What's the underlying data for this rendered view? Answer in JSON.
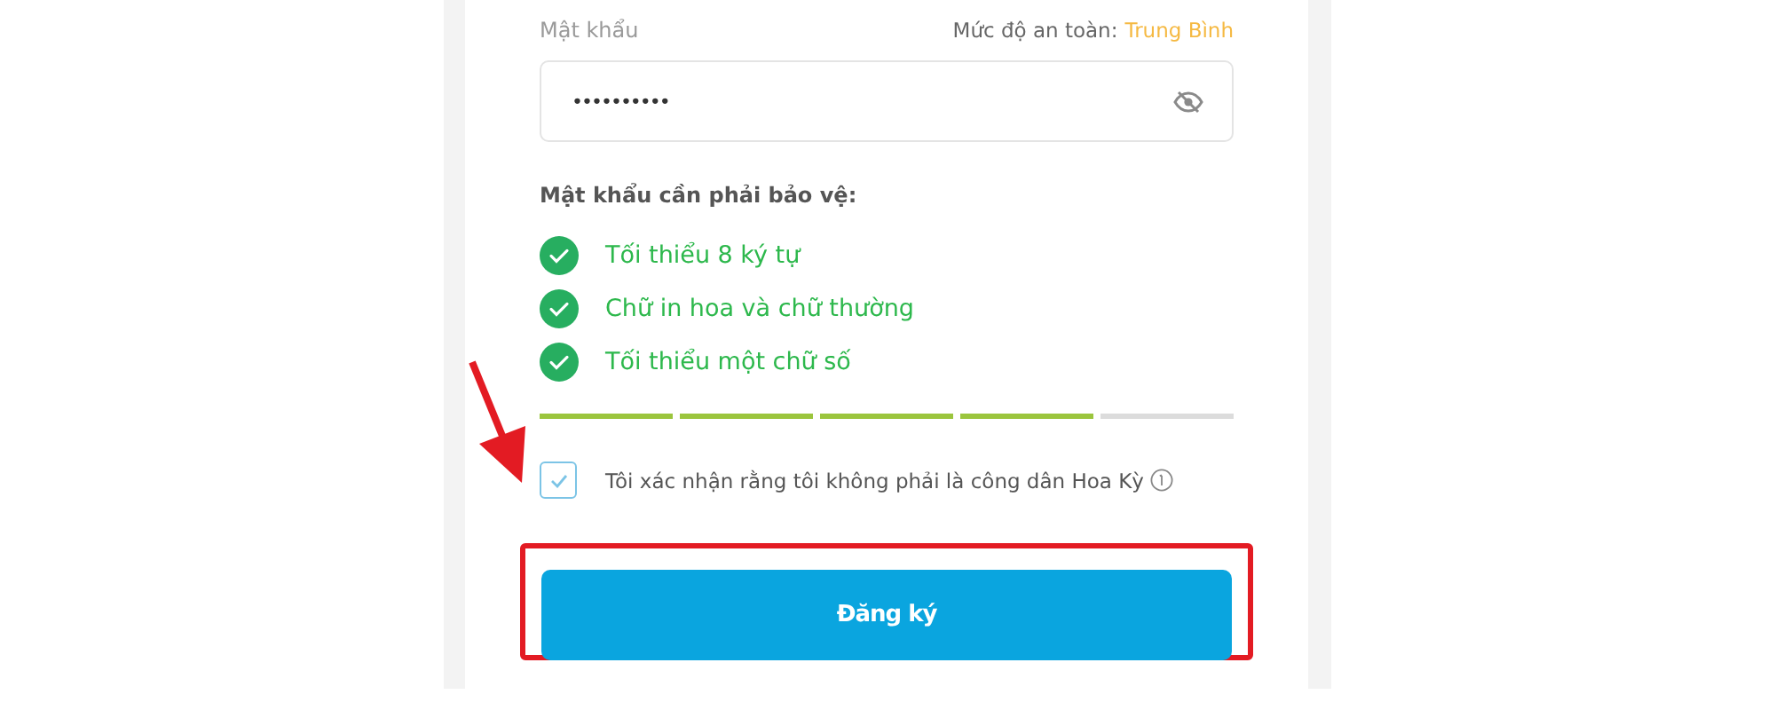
{
  "password_field": {
    "label": "Mật khẩu",
    "strength_label": "Mức độ an toàn:",
    "strength_value": "Trung Bình",
    "value": "••••••••••"
  },
  "requirements": {
    "title": "Mật khẩu cần phải bảo vệ:",
    "items": [
      {
        "text": "Tối thiểu 8 ký tự",
        "checked": true
      },
      {
        "text": "Chữ in hoa và chữ thường",
        "checked": true
      },
      {
        "text": "Tối thiểu một chữ số",
        "checked": true
      }
    ]
  },
  "strength_meter": [
    {
      "filled": true
    },
    {
      "filled": true
    },
    {
      "filled": true
    },
    {
      "filled": true
    },
    {
      "filled": false
    }
  ],
  "consent": {
    "text": "Tôi xác nhận rằng tôi không phải là công dân Hoa Kỳ",
    "checked": true
  },
  "submit_button": {
    "label": "Đăng ký",
    "highlighted": true
  },
  "annotation_arrow": true
}
